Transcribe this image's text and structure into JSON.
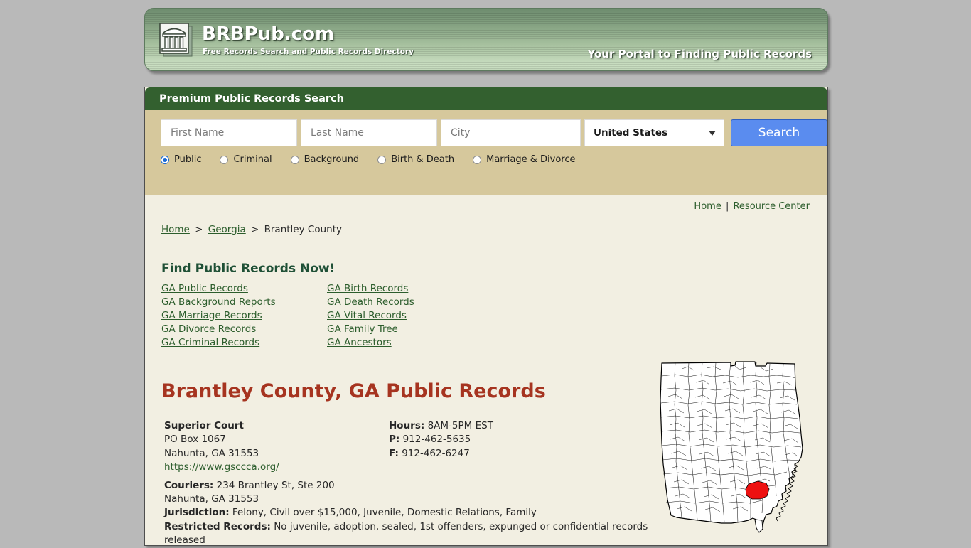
{
  "banner": {
    "logo_icon": "courthouse-icon",
    "brand_title": "BRBPub.com",
    "brand_subtitle": "Free Records Search and Public Records Directory",
    "tagline": "Your Portal to Finding Public Records"
  },
  "search_panel": {
    "title": "Premium Public Records Search",
    "fields": {
      "first_name_placeholder": "First Name",
      "last_name_placeholder": "Last Name",
      "city_placeholder": "City",
      "country_selected": "United States",
      "caret_icon": "chevron-down-icon"
    },
    "search_button": "Search",
    "radios": [
      {
        "label": "Public",
        "selected": true
      },
      {
        "label": "Criminal",
        "selected": false
      },
      {
        "label": "Background",
        "selected": false
      },
      {
        "label": "Birth & Death",
        "selected": false
      },
      {
        "label": "Marriage & Divorce",
        "selected": false
      }
    ]
  },
  "toplinks": {
    "home": "Home",
    "divider": "|",
    "resource_center": "Resource Center"
  },
  "breadcrumb": {
    "home": "Home",
    "sep1": ">",
    "state": "Georgia",
    "sep2": ">",
    "current": "Brantley County"
  },
  "find_records": {
    "heading": "Find Public Records Now!",
    "links_left": [
      "GA Public Records",
      "GA Background Reports",
      "GA Marriage Records",
      "GA Divorce Records",
      "GA Criminal Records"
    ],
    "links_right": [
      "GA Birth Records",
      "GA Death Records",
      "GA Vital Records",
      "GA Family Tree",
      "GA Ancestors"
    ]
  },
  "page_title": "Brantley County, GA Public Records",
  "court": {
    "name": "Superior Court",
    "address_line1": "PO Box 1067",
    "address_line2": "Nahunta, GA 31553",
    "website": "https://www.gsccca.org/",
    "hours_label": "Hours:",
    "hours_value": "8AM-5PM EST",
    "phone_label": "P:",
    "phone_value": "912-462-5635",
    "fax_label": "F:",
    "fax_value": "912-462-6247",
    "couriers_label": "Couriers:",
    "couriers_value": "234 Brantley St, Ste 200",
    "couriers_city": "Nahunta, GA 31553",
    "jurisdiction_label": "Jurisdiction:",
    "jurisdiction_value": "Felony, Civil over $15,000, Juvenile, Domestic Relations, Family",
    "restricted_label": "Restricted Records:",
    "restricted_value": "No juvenile, adoption, sealed, 1st offenders, expunged or confidential records released"
  },
  "map": {
    "name": "georgia-county-map",
    "highlight_county": "Brantley County",
    "highlight_color": "#ee1111",
    "outline_color": "#000000",
    "fill_color": "#ffffff"
  },
  "colors": {
    "page_background": "#b9b9b9",
    "content_background": "#f2efe2",
    "search_titlebar": "#33602f",
    "search_body": "#d6c89c",
    "link": "#2c5d2c",
    "title_red": "#a63420",
    "button_blue": "#5a8cef"
  }
}
